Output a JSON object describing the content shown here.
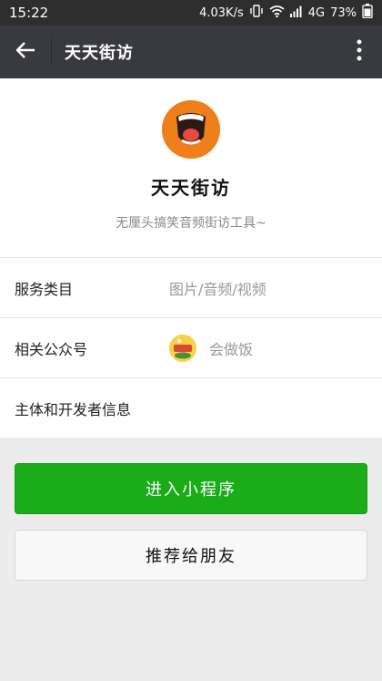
{
  "status_bar": {
    "time": "15:22",
    "speed": "4.03K/s",
    "network": "4G",
    "battery": "73%"
  },
  "app_bar": {
    "title": "天天街访"
  },
  "profile": {
    "name": "天天街访",
    "description": "无厘头搞笑音频街访工具~"
  },
  "info": {
    "service_label": "服务类目",
    "service_value": "图片/音频/视频",
    "account_label": "相关公众号",
    "account_value": "会做饭",
    "developer_label": "主体和开发者信息"
  },
  "actions": {
    "enter_label": "进入小程序",
    "share_label": "推荐给朋友"
  },
  "colors": {
    "status_bar": "#2e2e2e",
    "app_bar": "#393a3f",
    "primary_button": "#1aad19",
    "avatar_bg": "#ef7f1a"
  },
  "icons": [
    "back-arrow-icon",
    "more-vertical-icon",
    "vibrate-icon",
    "wifi-icon",
    "signal-icon",
    "battery-icon"
  ]
}
